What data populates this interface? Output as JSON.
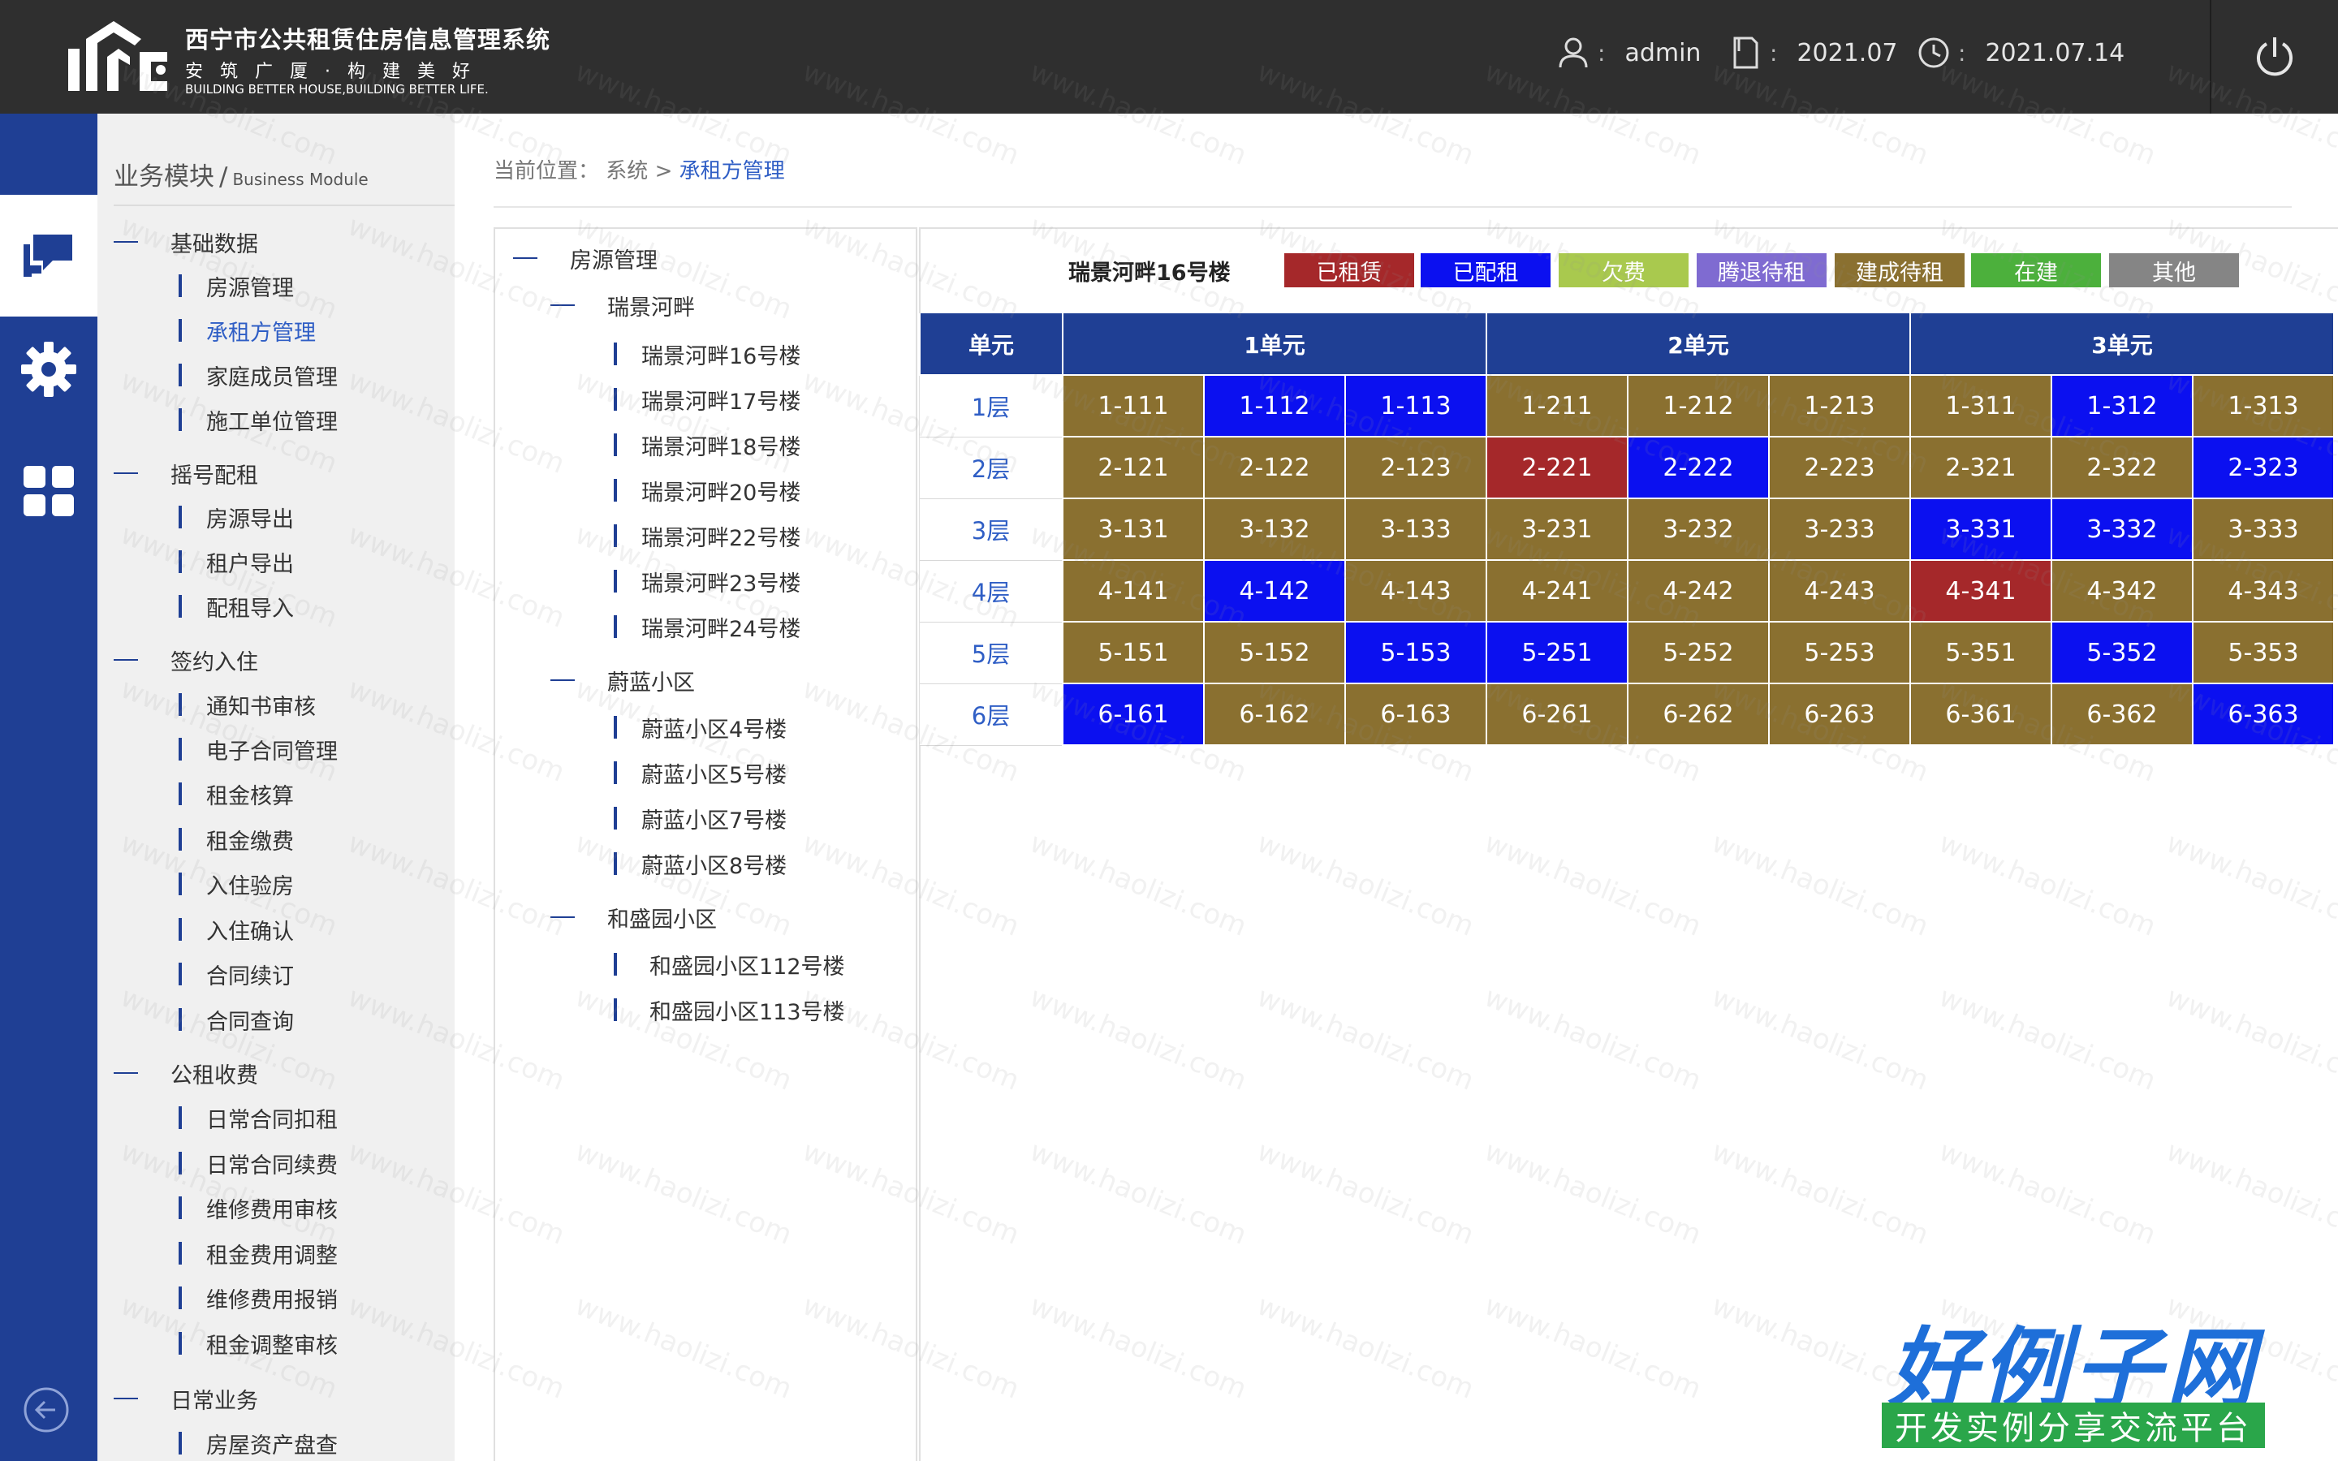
{
  "header": {
    "logo_title": "西宁市公共租赁住房信息管理系统",
    "logo_slogan": "安筑广厦·构建美好",
    "logo_en": "BUILDING BETTER HOUSE,BUILDING BETTER LIFE.",
    "user_label": "admin",
    "period_label": "2021.07",
    "date_label": "2021.07.14",
    "sep": ":",
    "icons": [
      "user-icon",
      "document-icon",
      "clock-icon",
      "power-icon"
    ]
  },
  "rail": {
    "icons": [
      "chat-icon",
      "gear-icon",
      "grid-icon",
      "back-arrow-icon"
    ]
  },
  "menu": {
    "head_cn": "业务模块",
    "head_sep": "/",
    "head_en": "Business Module",
    "groups": [
      {
        "label": "基础数据",
        "items": [
          "房源管理",
          "承租方管理",
          "家庭成员管理",
          "施工单位管理"
        ]
      },
      {
        "label": "摇号配租",
        "items": [
          "房源导出",
          "租户导出",
          "配租导入"
        ]
      },
      {
        "label": "签约入住",
        "items": [
          "通知书审核",
          "电子合同管理",
          "租金核算",
          "租金缴费",
          "入住验房",
          "入住确认",
          "合同续订",
          "合同查询"
        ]
      },
      {
        "label": "公租收费",
        "items": [
          "日常合同扣租",
          "日常合同续费",
          "维修费用审核",
          "租金费用调整",
          "维修费用报销",
          "租金调整审核"
        ]
      },
      {
        "label": "日常业务",
        "items": [
          "房屋资产盘查"
        ]
      }
    ]
  },
  "breadcrumb": {
    "prefix": "当前位置：",
    "level1": "系统",
    "arrow": ">",
    "current": "承租方管理"
  },
  "tree": {
    "root": "房源管理",
    "communities": [
      {
        "label": "瑞景河畔",
        "buildings": [
          "瑞景河畔16号楼",
          "瑞景河畔17号楼",
          "瑞景河畔18号楼",
          "瑞景河畔20号楼",
          "瑞景河畔22号楼",
          "瑞景河畔23号楼",
          "瑞景河畔24号楼"
        ]
      },
      {
        "label": "蔚蓝小区",
        "buildings": [
          "蔚蓝小区4号楼",
          "蔚蓝小区5号楼",
          "蔚蓝小区7号楼",
          "蔚蓝小区8号楼"
        ]
      },
      {
        "label": "和盛园小区",
        "buildings": [
          "和盛园小区112号楼",
          "和盛园小区113号楼"
        ]
      }
    ]
  },
  "grid": {
    "building_title": "瑞景河畔16号楼",
    "legend": [
      {
        "label": "已租赁",
        "color": "#a5282a"
      },
      {
        "label": "已配租",
        "color": "#0b10f0"
      },
      {
        "label": "欠费",
        "color": "#a9c94e"
      },
      {
        "label": "腾退待租",
        "color": "#7f6bd1"
      },
      {
        "label": "建成待租",
        "color": "#8a7030"
      },
      {
        "label": "在建",
        "color": "#4cb03c"
      },
      {
        "label": "其他",
        "color": "#858585"
      }
    ],
    "header_unit": "单元",
    "units": [
      "1单元",
      "2单元",
      "3单元"
    ],
    "floors": [
      {
        "label": "1层",
        "rooms": [
          [
            "1-111",
            "built"
          ],
          [
            "1-112",
            "assigned"
          ],
          [
            "1-113",
            "assigned"
          ],
          [
            "1-211",
            "built"
          ],
          [
            "1-212",
            "built"
          ],
          [
            "1-213",
            "built"
          ],
          [
            "1-311",
            "built"
          ],
          [
            "1-312",
            "assigned"
          ],
          [
            "1-313",
            "built"
          ]
        ]
      },
      {
        "label": "2层",
        "rooms": [
          [
            "2-121",
            "built"
          ],
          [
            "2-122",
            "built"
          ],
          [
            "2-123",
            "built"
          ],
          [
            "2-221",
            "leased"
          ],
          [
            "2-222",
            "assigned"
          ],
          [
            "2-223",
            "built"
          ],
          [
            "2-321",
            "built"
          ],
          [
            "2-322",
            "built"
          ],
          [
            "2-323",
            "assigned"
          ]
        ]
      },
      {
        "label": "3层",
        "rooms": [
          [
            "3-131",
            "built"
          ],
          [
            "3-132",
            "built"
          ],
          [
            "3-133",
            "built"
          ],
          [
            "3-231",
            "built"
          ],
          [
            "3-232",
            "built"
          ],
          [
            "3-233",
            "built"
          ],
          [
            "3-331",
            "assigned"
          ],
          [
            "3-332",
            "assigned"
          ],
          [
            "3-333",
            "built"
          ]
        ]
      },
      {
        "label": "4层",
        "rooms": [
          [
            "4-141",
            "built"
          ],
          [
            "4-142",
            "assigned"
          ],
          [
            "4-143",
            "built"
          ],
          [
            "4-241",
            "built"
          ],
          [
            "4-242",
            "built"
          ],
          [
            "4-243",
            "built"
          ],
          [
            "4-341",
            "leased"
          ],
          [
            "4-342",
            "built"
          ],
          [
            "4-343",
            "built"
          ]
        ]
      },
      {
        "label": "5层",
        "rooms": [
          [
            "5-151",
            "built"
          ],
          [
            "5-152",
            "built"
          ],
          [
            "5-153",
            "assigned"
          ],
          [
            "5-251",
            "assigned"
          ],
          [
            "5-252",
            "built"
          ],
          [
            "5-253",
            "built"
          ],
          [
            "5-351",
            "built"
          ],
          [
            "5-352",
            "assigned"
          ],
          [
            "5-353",
            "built"
          ]
        ]
      },
      {
        "label": "6层",
        "rooms": [
          [
            "6-161",
            "assigned"
          ],
          [
            "6-162",
            "built"
          ],
          [
            "6-163",
            "built"
          ],
          [
            "6-261",
            "built"
          ],
          [
            "6-262",
            "built"
          ],
          [
            "6-263",
            "built"
          ],
          [
            "6-361",
            "built"
          ],
          [
            "6-362",
            "built"
          ],
          [
            "6-363",
            "assigned"
          ]
        ]
      }
    ],
    "status_colors": {
      "leased": "#a5282a",
      "assigned": "#0b10f0",
      "built": "#8a7030"
    }
  },
  "watermark": {
    "text": "www.haolizi.com",
    "badge_title": "好例子网",
    "badge_sub": "开发实例分享交流平台"
  }
}
